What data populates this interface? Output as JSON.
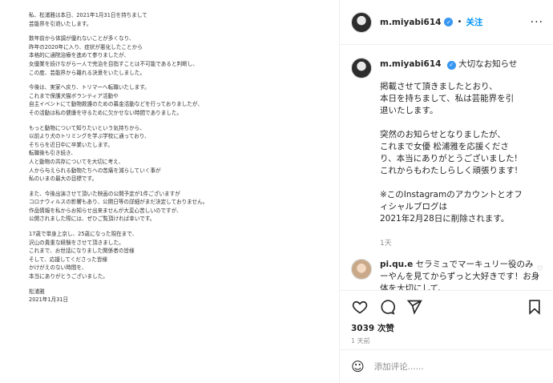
{
  "letter": {
    "paragraphs": [
      [
        "私、松浦雅は本日、2021年1月31日を持ちまして",
        "芸能界を引退いたします。"
      ],
      [
        "数年前から体調が優れないことが多くなり、",
        "昨年の2020年に入り、症状が悪化したことから",
        "本格的に通院治療を進めて参りましたが、",
        "女優業を続けながら一人で完治を目指すことは不可能であると判断し、",
        "この度、芸能界から離れる決意をいたしました。"
      ],
      [
        "今後は、実家へ戻り、トリマーへ転職いたします。",
        "これまで保護犬猫ボランティア活動や",
        "自主イベントにて動物救護のための募金活動などを行っておりましたが、",
        "その活動は私の健康を守るために欠かせない時間でありました。"
      ],
      [
        "もっと動物について知りたいという気持ちから、",
        "以前より犬のトリミングを学ぶ学校に通っており、",
        "そちらを近日中に卒業いたします。",
        "転職後も引き続き、",
        "人と動物の共存についてを大切に考え、",
        "人から与えられる動物たちへの苦痛を減らしていく事が",
        "私のいまの最大の目標です。"
      ],
      [
        "また、今後出演させて頂いた映画の公開予定が1件ございますが",
        "コロナウィルスの影響もあり、公開日等の詳細がまだ決定しておりません。",
        "作品情報を私からお知らせ出来ませんが大変心苦しいのですが、",
        "公開されました際には、ぜひご覧頂ければ幸いです。"
      ],
      [
        "17歳で単身上京し、25歳になった現在まで、",
        "沢山の貴重な経験をさせて頂きました。",
        "これまで、お世話になりました関係者の皆様",
        "そして、応援してくださった皆様",
        "かけがえのない時間を、",
        "本当にありがとうございました。"
      ],
      [
        "松浦雅",
        "2021年1月31日"
      ]
    ]
  },
  "header": {
    "username": "m.miyabi614",
    "separator": "•",
    "follow_label": "关注",
    "more": "···"
  },
  "caption": {
    "username": "m.miyabi614",
    "title": "大切なお知らせ",
    "paragraphs": [
      [
        "掲載させて頂きましたとおり、",
        "本日を持ちまして、私は芸能界を引",
        "退いたします。"
      ],
      [
        "突然のお知らせとなりましたが、",
        "これまで女優 松浦雅を応援くださ",
        "り、本当にありがとうございました!",
        "これからもわたしらしく頑張ります!"
      ],
      [
        "※このInstagramのアカウントとオフ",
        "ィシャルブログは",
        "2021年2月28日に削除されます。"
      ]
    ],
    "time": "1天"
  },
  "reply": {
    "username": "pi.qu.e",
    "text": "セラミュでマーキュリー役のみーやんを見てからずっと大好きです！お身体を大切にして、"
  },
  "likes": "3039 次赞",
  "time": "1 天前",
  "add_comment": {
    "placeholder": "添加评论......",
    "emoji": "☺"
  },
  "icons": [
    "heart-icon",
    "comment-icon",
    "share-icon",
    "bookmark-icon",
    "verified-icon",
    "emoji-icon"
  ]
}
